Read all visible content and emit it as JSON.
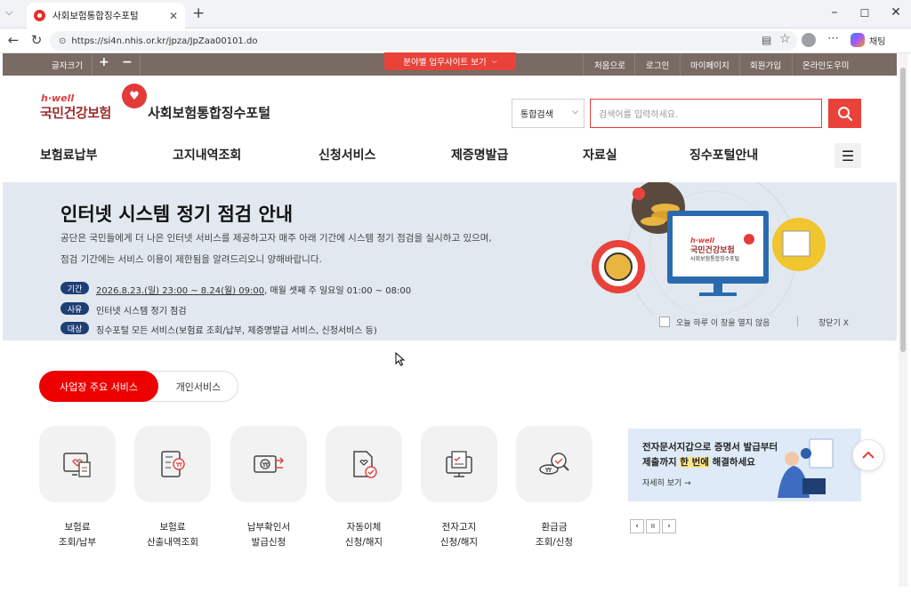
{
  "browser": {
    "tab_title": "사회보험통합징수포털",
    "url": "https://si4n.nhis.or.kr/jpza/JpZaa00101.do",
    "profile_label": "채팅"
  },
  "util": {
    "font_size_label": "글자크기",
    "plus": "+",
    "minus": "−",
    "biz_sites": "분야별 업무사이트 보기",
    "links": [
      "처음으로",
      "로그인",
      "마이페이지",
      "회원가입",
      "온라인도우미"
    ]
  },
  "header": {
    "logo_hwell": "h·well",
    "logo_org": "국민건강보험",
    "portal_name": "사회보험통합징수포털",
    "search_scope": "통합검색",
    "search_placeholder": "검색어를 입력하세요."
  },
  "gnb": [
    "보험료납부",
    "고지내역조회",
    "신청서비스",
    "제증명발급",
    "자료실",
    "징수포털안내"
  ],
  "notice": {
    "title": "인터넷 시스템 정기 점검 안내",
    "desc1": "공단은 국민들에게 더 나은 인터넷 서비스를 제공하고자 매주 아래 기간에 시스템 정기 점검을 실시하고 있으며,",
    "desc2": "점검 기간에는 서비스 이용이 제한됨을 알려드리오니 양해바랍니다.",
    "rows": [
      {
        "badge": "기간",
        "text_u": "2026.8.23.(일) 23:00 ~ 8.24(월) 09:00",
        "text": ", 매월 셋째 주 일요일 01:00 ~ 08:00"
      },
      {
        "badge": "사유",
        "text_u": "",
        "text": "인터넷 시스템 정기 점검"
      },
      {
        "badge": "대상",
        "text_u": "",
        "text": "징수포털 모든 서비스(보험료 조회/납부, 제증명발급 서비스, 신청서비스 등)"
      }
    ],
    "monitor_brand": "h·well",
    "monitor_org": "국민건강보험",
    "monitor_portal": "사회보험통합징수포털",
    "no_show_today": "오늘 하루 이 창을 열지 않음",
    "close": "창닫기 X"
  },
  "service_tabs": {
    "business": "사업장 주요 서비스",
    "personal": "개인서비스"
  },
  "services": [
    {
      "l1": "보험료",
      "l2": "조회/납부"
    },
    {
      "l1": "보험료",
      "l2": "산출내역조회"
    },
    {
      "l1": "납부확인서",
      "l2": "발급신청"
    },
    {
      "l1": "자동이체",
      "l2": "신청/해지"
    },
    {
      "l1": "전자고지",
      "l2": "신청/해지"
    },
    {
      "l1": "환급금",
      "l2": "조회/신청"
    }
  ],
  "banner": {
    "line1": "전자문서지갑으로 증명서 발급부터",
    "line2_a": "제출까지 ",
    "line2_b": "한 번에",
    "line2_c": " 해결하세요",
    "more": "자세히 보기 →",
    "prev": "‹",
    "pause": "II",
    "next": "›"
  },
  "colors": {
    "brand_red": "#e8423a",
    "util_bar": "#796a63",
    "notice_bg": "#e2e8ef",
    "badge_navy": "#1f3f74"
  }
}
